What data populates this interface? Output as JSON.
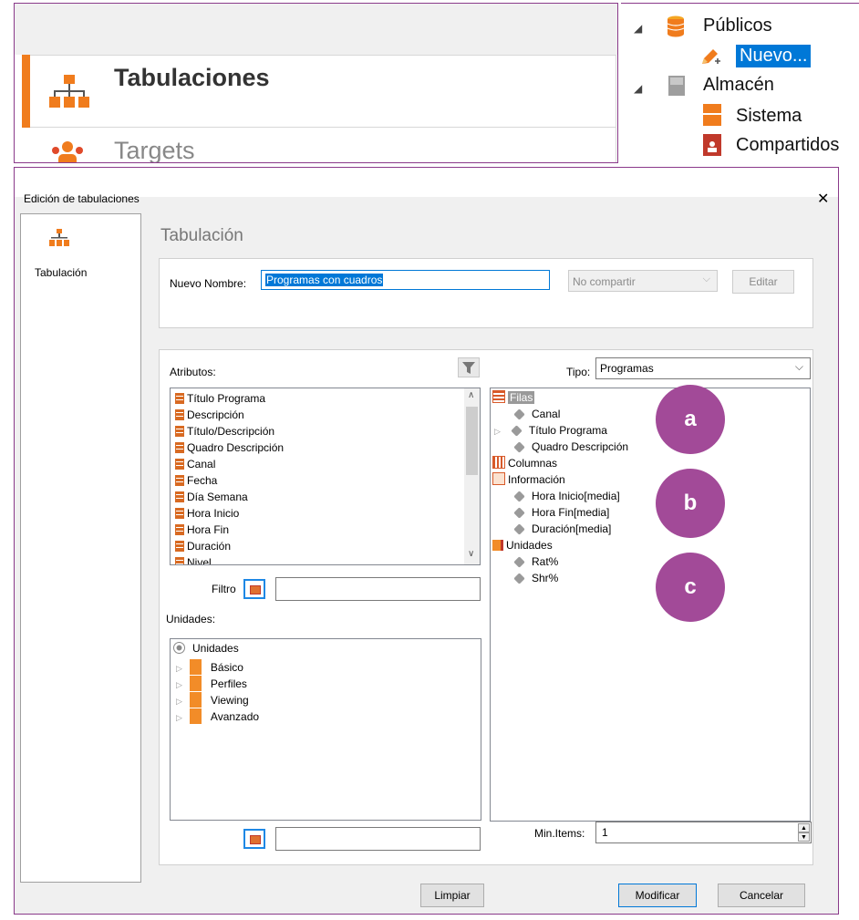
{
  "nav": {
    "items": [
      {
        "label": "Tabulaciones",
        "icon": "org-chart-icon",
        "active": true
      },
      {
        "label": "Targets",
        "icon": "people-icon",
        "active": false
      }
    ]
  },
  "tree": {
    "publicos": "Públicos",
    "nuevo": "Nuevo...",
    "almacen": "Almacén",
    "sistema": "Sistema",
    "compartidos": "Compartidos"
  },
  "dialog": {
    "title": "Edición de tabulaciones",
    "close_symbol": "✕",
    "sidebar_label": "Tabulación",
    "section_title": "Tabulación",
    "name_label": "Nuevo Nombre:",
    "name_value": "Programas con cuadros",
    "share_value": "No compartir",
    "edit_label": "Editar",
    "attributes_label": "Atributos:",
    "attributes": [
      "Título Programa",
      "Descripción",
      "Título/Descripción",
      "Quadro Descripción",
      "Canal",
      "Fecha",
      "Día Semana",
      "Hora Inicio",
      "Hora Fin",
      "Duración",
      "Nivel"
    ],
    "filter_label": "Filtro",
    "filter_value": "",
    "units_label": "Unidades:",
    "units_root": "Unidades",
    "units_children": [
      "Básico",
      "Perfiles",
      "Viewing",
      "Avanzado"
    ],
    "tipo_label": "Tipo:",
    "tipo_value": "Programas",
    "filas_label": "Filas",
    "filas": [
      "Canal",
      "Título Programa",
      "Quadro Descripción"
    ],
    "columnas_label": "Columnas",
    "informacion_label": "Información",
    "informacion": [
      "Hora Inicio[media]",
      "Hora Fin[media]",
      "Duración[media]"
    ],
    "unidades_label": "Unidades",
    "unidades": [
      "Rat%",
      "Shr%"
    ],
    "callouts": [
      "a",
      "b",
      "c"
    ],
    "min_items_label": "Min.Items:",
    "min_items_value": "1",
    "search_value": "",
    "btn_limpiar": "Limpiar",
    "btn_modificar": "Modificar",
    "btn_cancelar": "Cancelar"
  },
  "colors": {
    "accent_orange": "#f07c1d",
    "callout_purple": "#a24a98",
    "selection_blue": "#0078d7"
  }
}
